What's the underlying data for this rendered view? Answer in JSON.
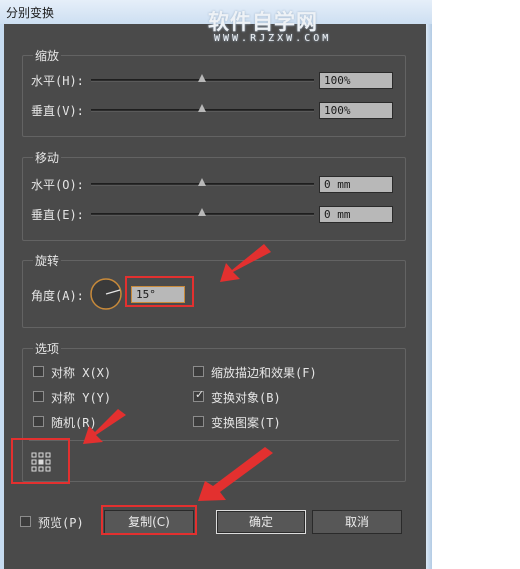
{
  "window": {
    "title": "分别变换"
  },
  "watermark": {
    "site": "软件自学网",
    "url": "WWW.RJZXW.COM"
  },
  "scale": {
    "title": "缩放",
    "horizontal": {
      "label": "水平(H):",
      "value": "100%"
    },
    "vertical": {
      "label": "垂直(V):",
      "value": "100%"
    }
  },
  "move": {
    "title": "移动",
    "horizontal": {
      "label": "水平(O):",
      "value": "0 mm"
    },
    "vertical": {
      "label": "垂直(E):",
      "value": "0 mm"
    }
  },
  "rotate": {
    "title": "旋转",
    "angle_label": "角度(A):",
    "angle_value": "15°"
  },
  "options": {
    "title": "选项",
    "reflect_x": {
      "label": "对称 X(X)",
      "checked": false
    },
    "reflect_y": {
      "label": "对称 Y(Y)",
      "checked": false
    },
    "random": {
      "label": "随机(R)",
      "checked": false
    },
    "scale_strokes": {
      "label": "缩放描边和效果(F)",
      "checked": false
    },
    "transform_objects": {
      "label": "变换对象(B)",
      "checked": true
    },
    "transform_patterns": {
      "label": "变换图案(T)",
      "checked": false
    }
  },
  "footer": {
    "preview": {
      "label": "预览(P)",
      "checked": false
    },
    "copy_label": "复制(C)",
    "ok_label": "确定",
    "cancel_label": "取消"
  },
  "colors": {
    "annotation": "#e3302f",
    "dialog_bg": "#4a4a4a"
  }
}
